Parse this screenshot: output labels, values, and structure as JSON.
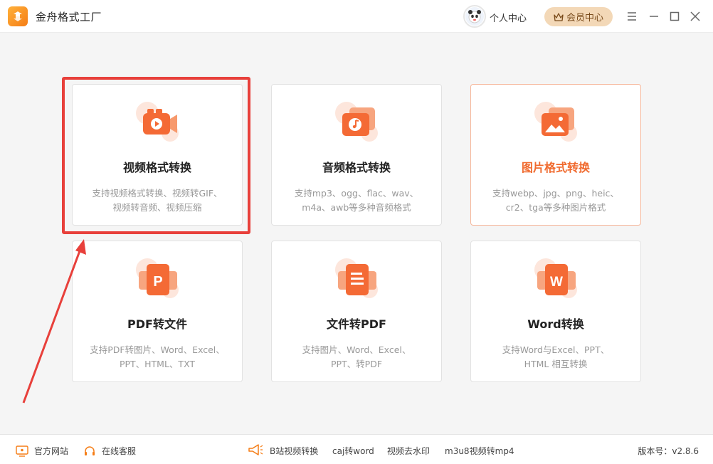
{
  "app": {
    "title": "金舟格式工厂",
    "brand_color": "#f57d16"
  },
  "header": {
    "user_center_label": "个人中心",
    "vip_label": "会员中心",
    "menu_icon": "menu-icon",
    "minimize_icon": "minimize-icon",
    "maximize_icon": "maximize-icon",
    "close_icon": "close-icon"
  },
  "cards": [
    {
      "title": "视频格式转换",
      "desc1": "支持视频格式转换、视频转GIF、",
      "desc2": "视频转音频、视频压缩",
      "icon": "video-icon"
    },
    {
      "title": "音频格式转换",
      "desc1": "支持mp3、ogg、flac、wav、",
      "desc2": "m4a、awb等多种音频格式",
      "icon": "music-icon"
    },
    {
      "title": "图片格式转换",
      "desc1": "支持webp、jpg、png、heic、",
      "desc2": "cr2、tga等多种图片格式",
      "icon": "image-icon"
    },
    {
      "title": "PDF转文件",
      "desc1": "支持PDF转图片、Word、Excel、",
      "desc2": "PPT、HTML、TXT",
      "icon": "pdf-p-icon",
      "glyph": "P"
    },
    {
      "title": "文件转PDF",
      "desc1": "支持图片、Word、Excel、",
      "desc2": "PPT、转PDF",
      "icon": "document-icon"
    },
    {
      "title": "Word转换",
      "desc1": "支持Word与Excel、PPT、",
      "desc2": "HTML 相互转换",
      "icon": "word-w-icon",
      "glyph": "W"
    }
  ],
  "footer": {
    "website_label": "官方网站",
    "service_label": "在线客服",
    "bilibili_label": "B站视频转换",
    "caj_label": "caj转word",
    "watermark_label": "视频去水印",
    "m3u8_label": "m3u8视频转mp4",
    "version_label": "版本号：v2.8.6"
  },
  "colors": {
    "card_accent": "#f06a2e",
    "highlight": "#e8403b",
    "vip_bg": "#f3d8b7"
  }
}
